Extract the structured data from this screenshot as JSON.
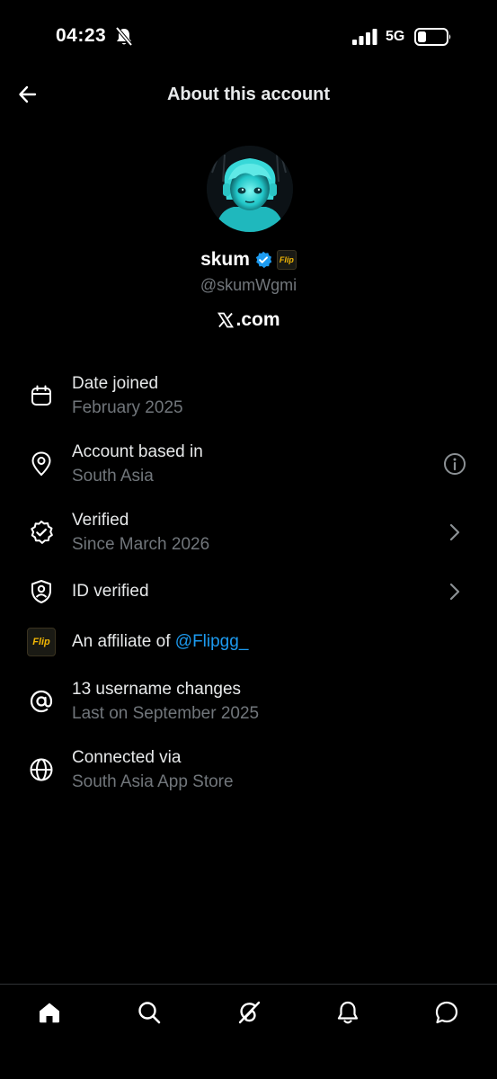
{
  "status_bar": {
    "time": "04:23",
    "network": "5G"
  },
  "header": {
    "title": "About this account"
  },
  "profile": {
    "display_name": "skum",
    "handle": "@skumWgmi",
    "affiliate_badge_text": "Flip",
    "domain": ".com"
  },
  "rows": [
    {
      "icon": "calendar-icon",
      "title": "Date joined",
      "subtitle": "February 2025"
    },
    {
      "icon": "location-pin-icon",
      "title": "Account based in",
      "subtitle": "South Asia",
      "trailing": "info-icon"
    },
    {
      "icon": "verified-check-icon",
      "title": "Verified",
      "subtitle": "Since March 2026",
      "trailing": "chevron-right-icon"
    },
    {
      "icon": "id-shield-icon",
      "title": "ID verified",
      "trailing": "chevron-right-icon"
    },
    {
      "icon": "affiliate-badge-icon",
      "title_prefix": "An affiliate of ",
      "title_link": "@Flipgg_"
    },
    {
      "icon": "at-sign-icon",
      "title": "13 username changes",
      "subtitle": "Last on September 2025"
    },
    {
      "icon": "globe-icon",
      "title": "Connected via",
      "subtitle": "South Asia App Store"
    }
  ],
  "bottom_nav": [
    "home-icon",
    "search-icon",
    "grok-icon",
    "notifications-icon",
    "messages-icon"
  ],
  "colors": {
    "background": "#000000",
    "primary_text": "#e7e9ea",
    "secondary_text": "#71767b",
    "link": "#1d9bf0",
    "verified_blue": "#1d9bf0",
    "affiliate_gold": "#f2b705"
  }
}
